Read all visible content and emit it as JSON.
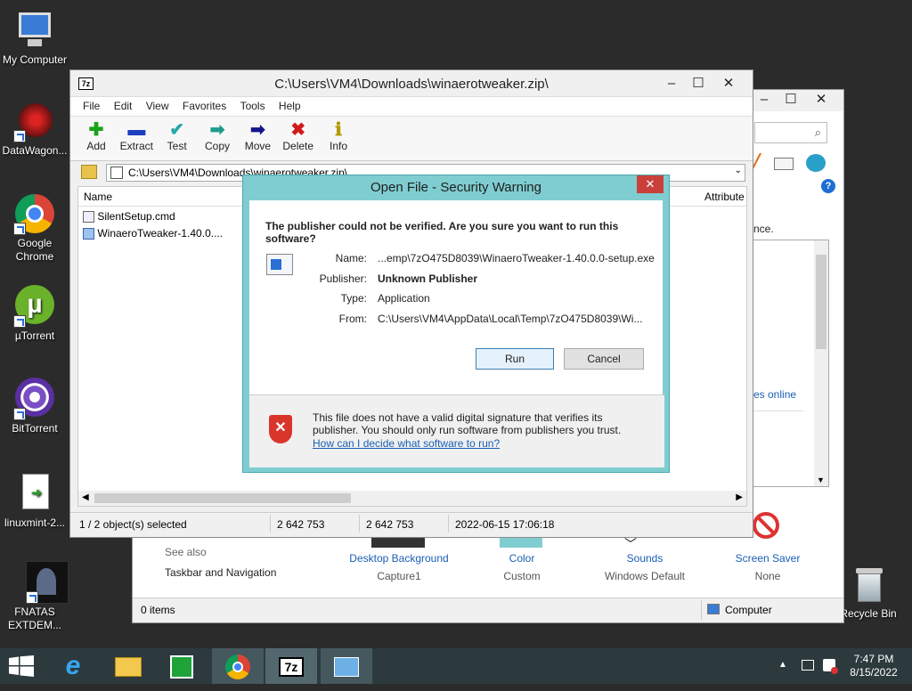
{
  "desktop": {
    "icons": [
      {
        "label": "My Computer"
      },
      {
        "label": "DataWagon..."
      },
      {
        "label": "Google Chrome"
      },
      {
        "label": "µTorrent"
      },
      {
        "label": "BitTorrent"
      },
      {
        "label": "linuxmint-2..."
      },
      {
        "label": "FNATAS EXTDEM..."
      },
      {
        "label": "Recycle Bin"
      }
    ]
  },
  "background_window": {
    "partial_text_1": "nce.",
    "partial_link": "es online",
    "see_also": "See also",
    "taskbar_nav": "Taskbar and Navigation",
    "items": [
      {
        "title": "Desktop Background",
        "value": "Capture1"
      },
      {
        "title": "Color",
        "value": "Custom"
      },
      {
        "title": "Sounds",
        "value": "Windows Default"
      },
      {
        "title": "Screen Saver",
        "value": "None"
      }
    ],
    "status_left": "0 items",
    "status_right": "Computer"
  },
  "zip_window": {
    "title": "C:\\Users\\VM4\\Downloads\\winaerotweaker.zip\\",
    "app_icon_text": "7z",
    "menu": [
      "File",
      "Edit",
      "View",
      "Favorites",
      "Tools",
      "Help"
    ],
    "toolbar": [
      {
        "label": "Add",
        "glyph": "✚",
        "color": "#1aa31a"
      },
      {
        "label": "Extract",
        "glyph": "▬",
        "color": "#1d3fbf"
      },
      {
        "label": "Test",
        "glyph": "✔",
        "color": "#2aa7a7"
      },
      {
        "label": "Copy",
        "glyph": "➡",
        "color": "#1e9a8c"
      },
      {
        "label": "Move",
        "glyph": "➡",
        "color": "#14148a"
      },
      {
        "label": "Delete",
        "glyph": "✖",
        "color": "#d11a1a"
      },
      {
        "label": "Info",
        "glyph": "ℹ",
        "color": "#b39a00"
      }
    ],
    "address": "C:\\Users\\VM4\\Downloads\\winaerotweaker.zip\\",
    "columns": {
      "name": "Name",
      "attributes": "Attribute"
    },
    "files": [
      {
        "name": "SilentSetup.cmd"
      },
      {
        "name": "WinaeroTweaker-1.40.0...."
      }
    ],
    "status": {
      "selected": "1 / 2 object(s) selected",
      "size1": "2 642 753",
      "size2": "2 642 753",
      "date": "2022-06-15 17:06:18"
    }
  },
  "dialog": {
    "title": "Open File - Security Warning",
    "question": "The publisher could not be verified.  Are you sure you want to run this software?",
    "fields": [
      {
        "label": "Name:",
        "value": "...emp\\7zO475D8039\\WinaeroTweaker-1.40.0.0-setup.exe",
        "bold": false
      },
      {
        "label": "Publisher:",
        "value": "Unknown Publisher",
        "bold": true
      },
      {
        "label": "Type:",
        "value": "Application",
        "bold": false
      },
      {
        "label": "From:",
        "value": "C:\\Users\\VM4\\AppData\\Local\\Temp\\7zO475D8039\\Wi...",
        "bold": false
      }
    ],
    "run_label": "Run",
    "cancel_label": "Cancel",
    "warning_text": "This file does not have a valid digital signature that verifies its publisher.  You should only run software from publishers you trust.",
    "help_link": "How can I decide what software to run?"
  },
  "taskbar": {
    "time": "7:47 PM",
    "date": "8/15/2022"
  }
}
